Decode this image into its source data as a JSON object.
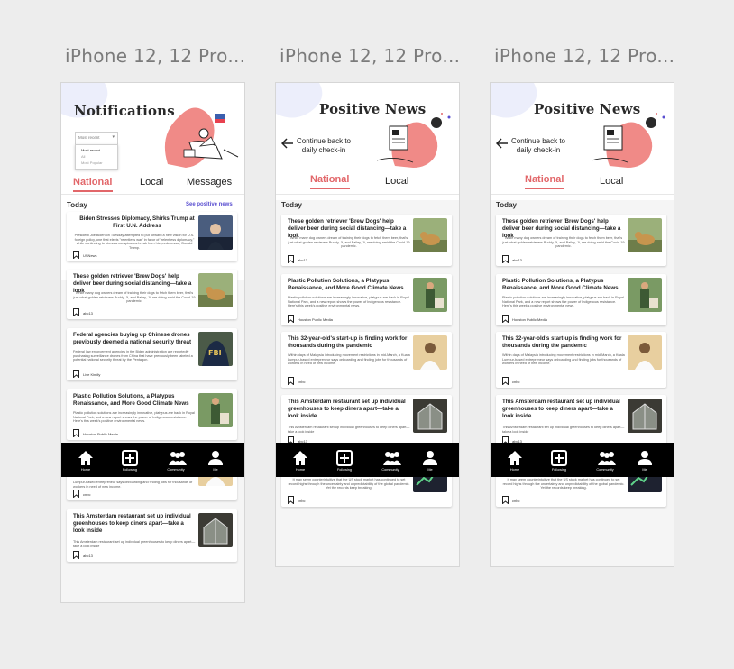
{
  "frames": [
    {
      "frame_title": "iPhone 12, 12 Pro...",
      "screen_title": "Notifications",
      "sort": {
        "selected": "Most recent",
        "options": [
          "Most recent",
          "All",
          "Most Popular"
        ]
      },
      "tabs": [
        "National",
        "Local",
        "Messages"
      ],
      "section": "Today",
      "positive_link": "See positive news",
      "cards": [
        {
          "headline": "Biden Stresses Diplomacy, Shirks Trump at First U.N. Address",
          "body": "President Joe Biden on Tuesday attempted to put forward a new vision for U.S. foreign policy, one that elects \"relentless war\" in favor of \"relentless diplomacy,\" while continuing to stress a conspicuous break from his predecessor, Donald Trump.",
          "source": "USNews",
          "thumb": "biden"
        },
        {
          "headline": "These golden retriever 'Brew Dogs' help deliver beer during social distancing—take a look",
          "body": "While many dog owners dream of training their dogs to fetch them beer, that's just what golden retrievers Buddy, Ji, and Bailey, Ji, are doing amid the Covid-19 pandemic.",
          "source": "abc13",
          "thumb": "dog"
        },
        {
          "headline": "Federal agencies buying up Chinese drones previously deemed a national security threat",
          "body": "Federal law enforcement agencies in the Biden administration are reportedly purchasing surveillance drones from China that have previously been labeled a potential national security threat by the Pentagon.",
          "source": "Live Kindly",
          "thumb": "fbi"
        },
        {
          "headline": "Plastic Pollution Solutions, a Platypus Renaissance, and More Good Climate News",
          "body": "Plastic pollution solutions are increasingly innovative, platypus are back in Royal National Park, and a new report shows the power of Indigenous resistance. Here's this week's positive environmental news.",
          "source": "Houston Public Media",
          "thumb": "plastic"
        },
        {
          "headline": "",
          "body": "Lumpur-based entrepreneur says onboarding and finding jobs for thousands of workers in need of new income.",
          "source": "cnbc",
          "thumb": "woman"
        },
        {
          "headline": "This Amsterdam restaurant set up individual greenhouses to keep diners apart—take a look inside",
          "body": "This Amsterdam restaurant set up individual greenhouses to keep diners apart—take a look inside",
          "source": "abc13",
          "thumb": "greenhouse"
        }
      ]
    },
    {
      "frame_title": "iPhone 12, 12 Pro...",
      "screen_title": "Positive News",
      "back": "Continue back to daily check-in",
      "tabs": [
        "National",
        "Local"
      ],
      "section": "Today",
      "cards": [
        {
          "headline": "These golden retriever 'Brew Dogs' help deliver beer during social distancing—take a look",
          "body": "While many dog owners dream of training their dogs to fetch them beer, that's just what golden retrievers Buddy, Ji, and Bailey, Ji, are doing amid the Covid-19 pandemic.",
          "source": "abc13",
          "thumb": "dog"
        },
        {
          "headline": "Plastic Pollution Solutions, a Platypus Renaissance, and More Good Climate News",
          "body": "Plastic pollution solutions are increasingly innovative, platypus are back in Royal National Park, and a new report shows the power of Indigenous resistance. Here's this week's positive environmental news.",
          "source": "Houston Public Media",
          "thumb": "plastic"
        },
        {
          "headline": "This 32-year-old's start-up is finding work for thousands during the pandemic",
          "body": "Within days of Malaysia introducing movement restrictions in mid-March, a Kuala Lumpur-based entrepreneur says onboarding and finding jobs for thousands of workers in need of new income.",
          "source": "cnbc",
          "thumb": "woman"
        },
        {
          "headline": "This Amsterdam restaurant set up individual greenhouses to keep diners apart—take a look inside",
          "body": "This Amsterdam restaurant set up individual greenhouses to keep diners apart—take a look inside",
          "source": "abc13",
          "thumb": "greenhouse"
        },
        {
          "headline": "",
          "body": "It may seem counterintuitive that the US stock market has continued to set record highs through the uncertainty and unpredictability of the global pandemic. Yet the records keep breaking.",
          "source": "cnbc",
          "thumb": "stocks"
        }
      ]
    },
    {
      "frame_title": "iPhone 12, 12 Pro...",
      "screen_title": "Positive News",
      "back": "Continue back to daily check-in",
      "tabs": [
        "National",
        "Local"
      ],
      "section": "Today",
      "cards": [
        {
          "headline": "These golden retriever 'Brew Dogs' help deliver beer during social distancing—take a look",
          "body": "While many dog owners dream of training their dogs to fetch them beer, that's just what golden retrievers Buddy, Ji, and Bailey, Ji, are doing amid the Covid-19 pandemic.",
          "source": "abc13",
          "thumb": "dog"
        },
        {
          "headline": "Plastic Pollution Solutions, a Platypus Renaissance, and More Good Climate News",
          "body": "Plastic pollution solutions are increasingly innovative, platypus are back in Royal National Park, and a new report shows the power of Indigenous resistance. Here's this week's positive environmental news.",
          "source": "Houston Public Media",
          "thumb": "plastic"
        },
        {
          "headline": "This 32-year-old's start-up is finding work for thousands during the pandemic",
          "body": "Within days of Malaysia introducing movement restrictions in mid-March, a Kuala Lumpur-based entrepreneur says onboarding and finding jobs for thousands of workers in need of new income.",
          "source": "cnbc",
          "thumb": "woman"
        },
        {
          "headline": "This Amsterdam restaurant set up individual greenhouses to keep diners apart—take a look inside",
          "body": "This Amsterdam restaurant set up individual greenhouses to keep diners apart—take a look inside",
          "source": "abc13",
          "thumb": "greenhouse"
        },
        {
          "headline": "",
          "body": "It may seem counterintuitive that the US stock market has continued to set record highs through the uncertainty and unpredictability of the global pandemic. Yet the records keep breaking.",
          "source": "cnbc",
          "thumb": "stocks"
        }
      ]
    }
  ],
  "bottom_nav": [
    {
      "label": "Home",
      "icon": "home-icon"
    },
    {
      "label": "Following",
      "icon": "plus-square-icon"
    },
    {
      "label": "Community",
      "icon": "community-icon"
    },
    {
      "label": "Me",
      "icon": "person-icon"
    }
  ],
  "colors": {
    "accent": "#e2676a",
    "link": "#5a4fd0",
    "nav_bg": "#000000",
    "art_pink": "#f08a87",
    "blob": "#eceefb"
  }
}
